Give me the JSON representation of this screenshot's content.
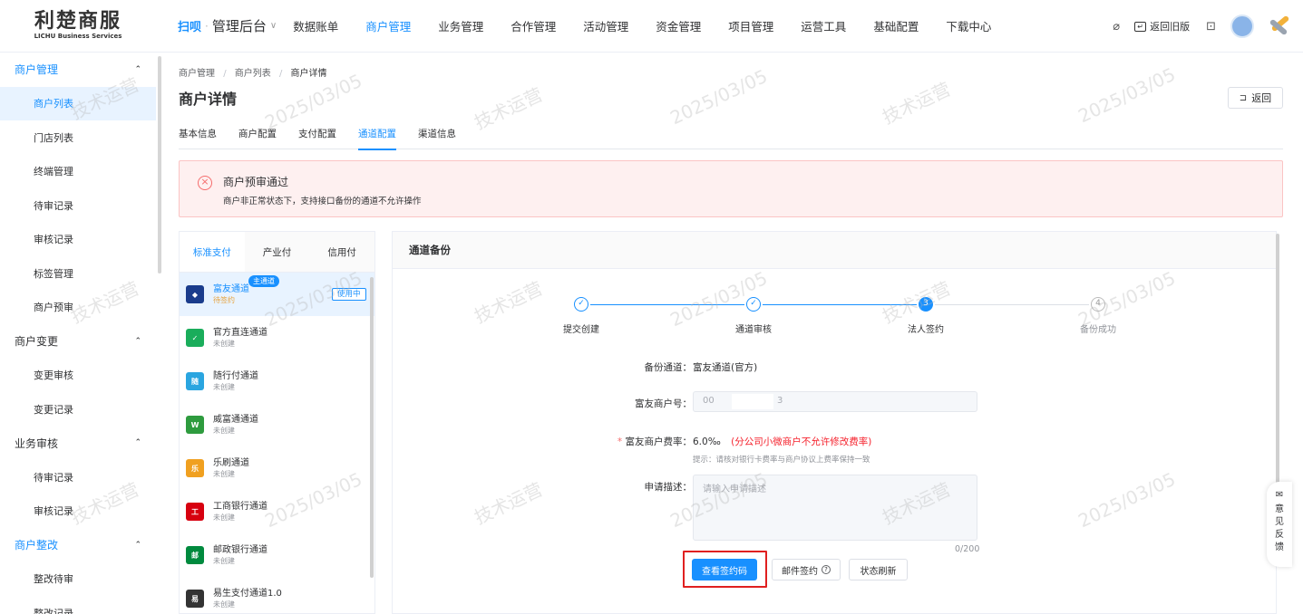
{
  "logo": {
    "main": "利楚商服",
    "sub": "LICHU Business Services"
  },
  "brand": {
    "mark": "扫呗",
    "title": "管理后台",
    "caret": "∨"
  },
  "topnav": [
    {
      "label": "数据账单",
      "active": false
    },
    {
      "label": "商户管理",
      "active": true
    },
    {
      "label": "业务管理",
      "active": false
    },
    {
      "label": "合作管理",
      "active": false
    },
    {
      "label": "活动管理",
      "active": false
    },
    {
      "label": "资金管理",
      "active": false
    },
    {
      "label": "项目管理",
      "active": false
    },
    {
      "label": "运营工具",
      "active": false
    },
    {
      "label": "基础配置",
      "active": false
    },
    {
      "label": "下载中心",
      "active": false
    }
  ],
  "top_right": {
    "back_old": "返回旧版"
  },
  "sidebar": [
    {
      "type": "group",
      "label": "商户管理",
      "active": true
    },
    {
      "type": "item",
      "label": "商户列表",
      "active": true
    },
    {
      "type": "item",
      "label": "门店列表"
    },
    {
      "type": "item",
      "label": "终端管理"
    },
    {
      "type": "item",
      "label": "待审记录"
    },
    {
      "type": "item",
      "label": "审核记录"
    },
    {
      "type": "item",
      "label": "标签管理"
    },
    {
      "type": "item",
      "label": "商户预审"
    },
    {
      "type": "group",
      "label": "商户变更"
    },
    {
      "type": "item",
      "label": "变更审核"
    },
    {
      "type": "item",
      "label": "变更记录"
    },
    {
      "type": "group",
      "label": "业务审核"
    },
    {
      "type": "item",
      "label": "待审记录"
    },
    {
      "type": "item",
      "label": "审核记录"
    },
    {
      "type": "group",
      "label": "商户整改",
      "active": true
    },
    {
      "type": "item",
      "label": "整改待审"
    },
    {
      "type": "item",
      "label": "整改记录"
    }
  ],
  "breadcrumb": {
    "l1": "商户管理",
    "l2": "商户列表",
    "l3": "商户详情",
    "sep": "/"
  },
  "page_title": "商户详情",
  "back_button": "返回",
  "tabs": [
    {
      "label": "基本信息"
    },
    {
      "label": "商户配置"
    },
    {
      "label": "支付配置"
    },
    {
      "label": "通道配置",
      "active": true
    },
    {
      "label": "渠道信息"
    }
  ],
  "alert": {
    "title": "商户预审通过",
    "desc": "商户非正常状态下，支持接口备份的通道不允许操作"
  },
  "channel_tabs": [
    {
      "label": "标准支付",
      "active": true
    },
    {
      "label": "产业付"
    },
    {
      "label": "信用付"
    }
  ],
  "channels": [
    {
      "name": "富友通道",
      "status": "待签约",
      "logo_color": "#1a3c8c",
      "logo_text": "◆",
      "active": true,
      "badge": "主通道",
      "in_use": "使用中"
    },
    {
      "name": "官方直连通道",
      "status": "未创建",
      "logo_color": "#1aad5b",
      "logo_text": "✓"
    },
    {
      "name": "随行付通道",
      "status": "未创建",
      "logo_color": "#2aa5e0",
      "logo_text": "随"
    },
    {
      "name": "威富通通道",
      "status": "未创建",
      "logo_color": "#2e9b3e",
      "logo_text": "W"
    },
    {
      "name": "乐刷通道",
      "status": "未创建",
      "logo_color": "#f0a020",
      "logo_text": "乐"
    },
    {
      "name": "工商银行通道",
      "status": "未创建",
      "logo_color": "#d7000f",
      "logo_text": "工"
    },
    {
      "name": "邮政银行通道",
      "status": "未创建",
      "logo_color": "#008a3e",
      "logo_text": "邮"
    },
    {
      "name": "易生支付通道1.0",
      "status": "未创建",
      "logo_color": "#333333",
      "logo_text": "易"
    }
  ],
  "backup": {
    "title": "通道备份",
    "steps": [
      {
        "label": "提交创建",
        "state": "done",
        "mark": "✓"
      },
      {
        "label": "通道审核",
        "state": "done",
        "mark": "✓"
      },
      {
        "label": "法人签约",
        "state": "current",
        "mark": "3"
      },
      {
        "label": "备份成功",
        "state": "todo",
        "mark": "4"
      }
    ],
    "channel_label": "备份通道：",
    "channel_value": "富友通道(官方)",
    "merchant_no_label": "富友商户号：",
    "merchant_no_value": "00",
    "merchant_no_tail": "3",
    "rate_required": "*",
    "rate_label": "富友商户费率：",
    "rate_value": "6.0‰",
    "rate_warning": "(分公司小微商户不允许修改费率)",
    "rate_hint": "提示：请核对银行卡费率与商户协议上费率保持一致",
    "desc_label": "申请描述：",
    "desc_placeholder": "请输入申请描述",
    "counter": "0/200",
    "btn_view_code": "查看签约码",
    "btn_email_sign": "邮件签约",
    "btn_refresh": "状态刷新"
  },
  "feedback": [
    "意",
    "见",
    "反",
    "馈"
  ],
  "watermark": {
    "text1": "技术运营",
    "text2": "2025/03/05"
  }
}
